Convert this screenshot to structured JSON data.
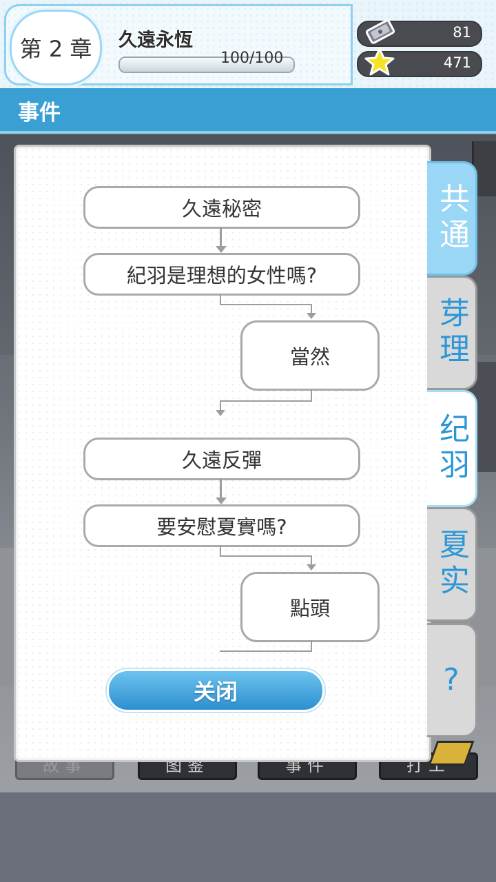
{
  "header": {
    "chapter_label": "第 2 章",
    "chapter_title": "久遠永恆",
    "progress_text": "100/100",
    "progress_fraction": 1.0,
    "tickets": "81",
    "stars": "471"
  },
  "section": {
    "title": "事件"
  },
  "bottom_nav": [
    "故事",
    "图鉴",
    "事件",
    "打工"
  ],
  "side_tabs": [
    {
      "label": "共通",
      "state": "current"
    },
    {
      "label": "芽理",
      "state": "normal"
    },
    {
      "label": "纪羽",
      "state": "active"
    },
    {
      "label": "夏实",
      "state": "normal"
    },
    {
      "label": "?",
      "state": "normal"
    }
  ],
  "flow": {
    "event1": "久遠秘密",
    "question1": "紀羽是理想的女性嗎?",
    "answer1": "當然",
    "event2": "久遠反彈",
    "question2": "要安慰夏實嗎?",
    "answer2": "點頭"
  },
  "close_label": "关闭",
  "colors": {
    "accent": "#3a9fd3",
    "tab_text": "#2c97d8",
    "button": "#2d8fd0"
  }
}
